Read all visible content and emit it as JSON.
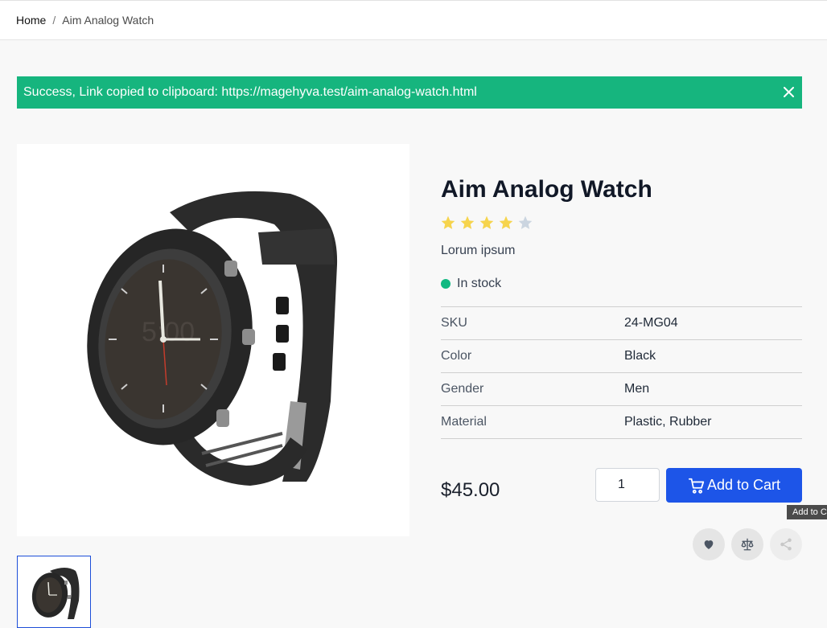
{
  "breadcrumb": {
    "home": "Home",
    "separator": "/",
    "current": "Aim Analog Watch"
  },
  "alert": {
    "message": "Success, Link copied to clipboard: https://magehyva.test/aim-analog-watch.html",
    "color": "#16b57e"
  },
  "product": {
    "title": "Aim Analog Watch",
    "rating": {
      "value": 4,
      "max": 5
    },
    "short_description": "Lorum ipsum",
    "stock": "In stock",
    "attributes": [
      {
        "label": "SKU",
        "value": "24-MG04"
      },
      {
        "label": "Color",
        "value": "Black"
      },
      {
        "label": "Gender",
        "value": "Men"
      },
      {
        "label": "Material",
        "value": "Plastic, Rubber"
      }
    ],
    "price": "$45.00",
    "quantity": "1"
  },
  "actions": {
    "add_to_cart": "Add to Cart",
    "tooltip": "Add to C"
  },
  "icons": {
    "close": "close-icon",
    "star": "star-icon",
    "cart": "cart-icon",
    "heart": "heart-icon",
    "compare": "scale-icon",
    "share": "share-icon"
  },
  "colors": {
    "accent": "#1d55e8",
    "success": "#16b57e",
    "star_filled": "#f6d44d",
    "star_empty": "#cbd5e0",
    "in_stock": "#10b981"
  }
}
